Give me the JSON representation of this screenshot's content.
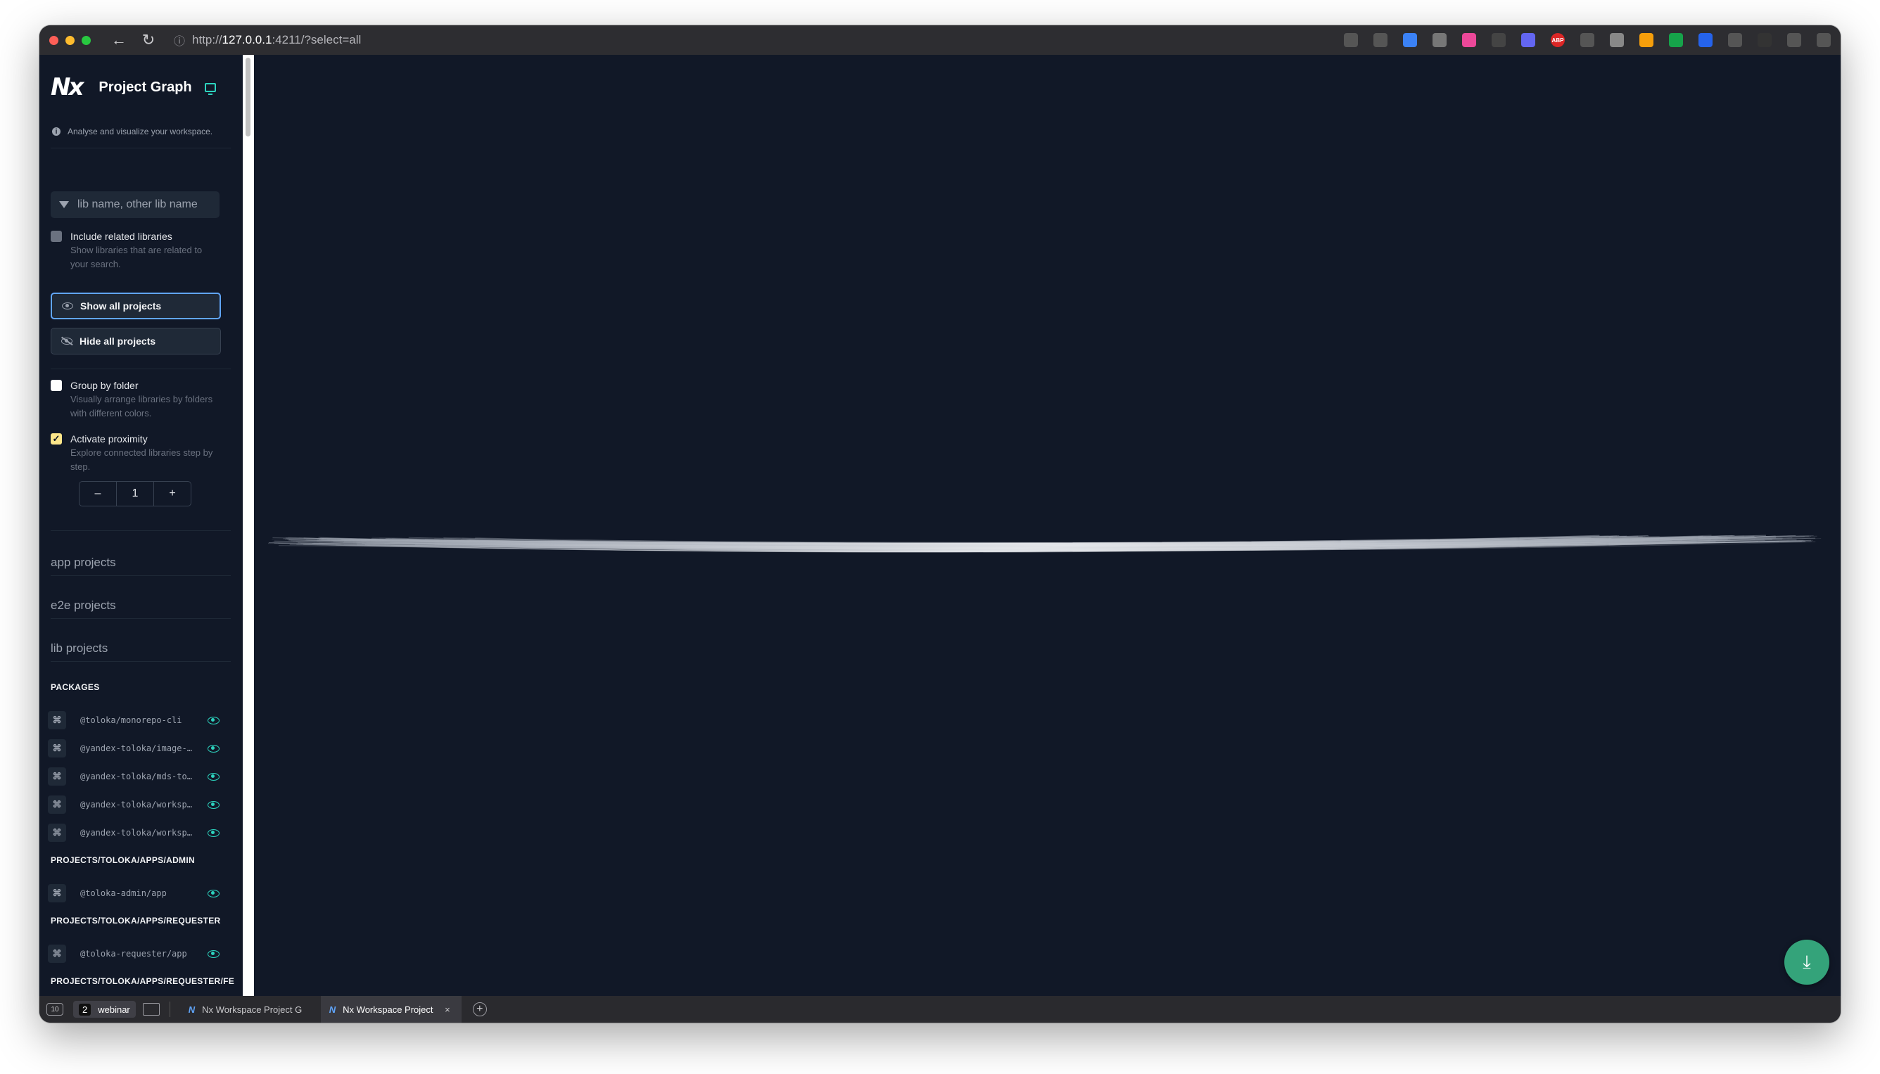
{
  "browser": {
    "url_prefix": "http://",
    "url_host": "127.0.0.1",
    "url_rest": ":4211/?select=all",
    "extensions": [
      {
        "name": "translate-icon",
        "color": "#555"
      },
      {
        "name": "bookmark-icon",
        "color": "#555"
      },
      {
        "name": "compass-icon",
        "color": "#3b82f6"
      },
      {
        "name": "record-icon",
        "color": "#777"
      },
      {
        "name": "gradient-icon",
        "color": "#ec4899"
      },
      {
        "name": "react-icon",
        "color": "#444"
      },
      {
        "name": "book-icon",
        "color": "#6366f1"
      },
      {
        "name": "abp-icon",
        "color": "#dc2626",
        "text": "ABP"
      },
      {
        "name": "pen-icon",
        "color": "#555"
      },
      {
        "name": "globe-icon",
        "color": "#888"
      },
      {
        "name": "fox-icon",
        "color": "#f59e0b"
      },
      {
        "name": "sheet-icon",
        "color": "#16a34a"
      },
      {
        "name": "doc-check-icon",
        "color": "#2563eb"
      },
      {
        "name": "download-badge-icon",
        "color": "#555"
      },
      {
        "name": "contrast-icon",
        "color": "#333"
      },
      {
        "name": "puzzle-icon",
        "color": "#555"
      },
      {
        "name": "menu-icon",
        "color": "#555"
      }
    ]
  },
  "sidebar": {
    "logo": "Nx",
    "title": "Project Graph",
    "info": "Analyse and visualize your workspace.",
    "search_placeholder": "lib name, other lib name",
    "include_related": {
      "label": "Include related libraries",
      "desc": "Show libraries that are related to your search."
    },
    "show_all": "Show all projects",
    "hide_all": "Hide all projects",
    "group_by_folder": {
      "label": "Group by folder",
      "desc": "Visually arrange libraries by folders with different colors."
    },
    "proximity": {
      "label": "Activate proximity",
      "desc": "Explore connected libraries step by step.",
      "checked": true
    },
    "stepper": {
      "minus": "–",
      "value": "1",
      "plus": "+"
    },
    "sections": [
      "app projects",
      "e2e projects",
      "lib projects"
    ],
    "groups": [
      {
        "name": "PACKAGES",
        "items": [
          "@toloka/monorepo-cli",
          "@yandex-toloka/image-…",
          "@yandex-toloka/mds-to…",
          "@yandex-toloka/worksp…",
          "@yandex-toloka/worksp…"
        ]
      },
      {
        "name": "PROJECTS/TOLOKA/APPS/ADMIN",
        "items": [
          "@toloka-admin/app"
        ]
      },
      {
        "name": "PROJECTS/TOLOKA/APPS/REQUESTER",
        "items": [
          "@toloka-requester/app"
        ]
      },
      {
        "name": "PROJECTS/TOLOKA/APPS/REQUESTER/FE",
        "items": []
      }
    ]
  },
  "bottom": {
    "space_num": "2",
    "space_name": "webinar",
    "tabs": [
      {
        "title": "Nx Workspace Project G",
        "active": false
      },
      {
        "title": "Nx Workspace Project",
        "active": true,
        "close": "×"
      }
    ],
    "new_tab": "+"
  }
}
